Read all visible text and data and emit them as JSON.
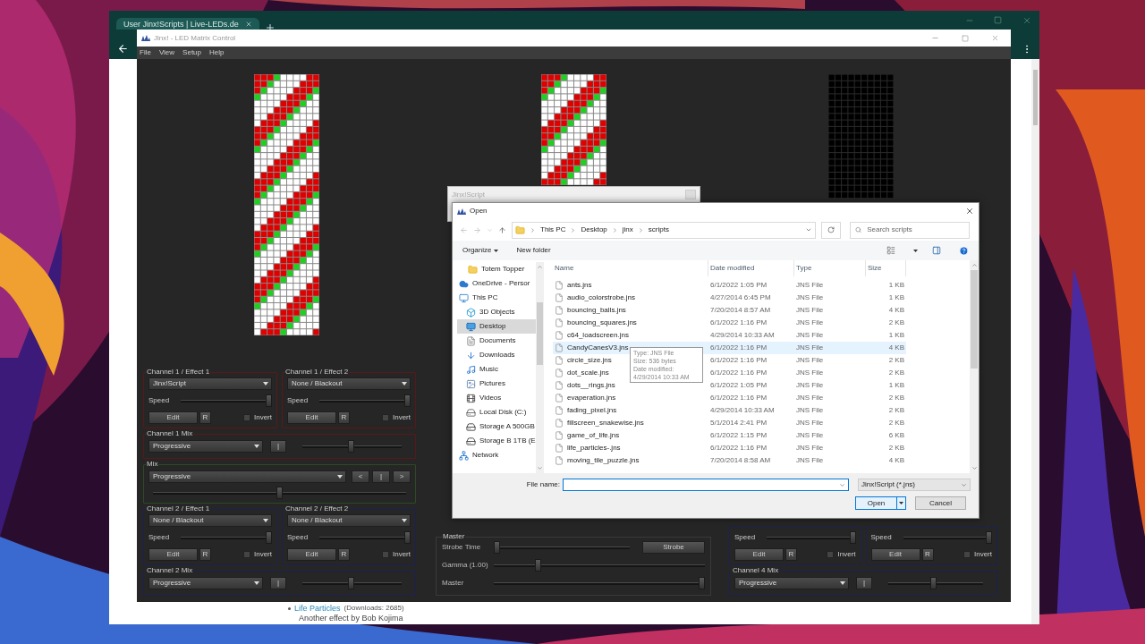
{
  "browser": {
    "tab_title": "User Jinx!Scripts | Live-LEDs.de"
  },
  "app": {
    "title": "Jinx! - LED Matrix Control",
    "menu": [
      "File",
      "View",
      "Setup",
      "Help"
    ]
  },
  "previews": [
    {
      "kind": "pattern"
    },
    {
      "kind": "pattern"
    },
    {
      "kind": "blank"
    }
  ],
  "left_panel": [
    {
      "kind": "effects",
      "color": "#5a1818",
      "effects": [
        {
          "title": "Channel 1 / Effect 1",
          "effect": "Jinx!Script",
          "speed": {
            "label": "Speed",
            "level": 1
          },
          "edit": "Edit",
          "reset": "R",
          "invert": {
            "label": "Invert",
            "checked": false
          }
        },
        {
          "title": "Channel 1 / Effect 2",
          "effect": "None / Blackout",
          "speed": {
            "label": "Speed",
            "level": 1
          },
          "edit": "Edit",
          "reset": "R",
          "invert": {
            "label": "Invert",
            "checked": false
          }
        }
      ]
    },
    {
      "kind": "channel_mix",
      "color": "#5a1818",
      "title": "Channel 1 Mix",
      "mode": "Progressive",
      "toggle": "|",
      "level": 0.49
    },
    {
      "kind": "mix",
      "color": "#2c4a24",
      "title": "Mix",
      "mode": "Progressive",
      "buttons": [
        "<",
        "|",
        ">"
      ],
      "level": 0.5
    },
    {
      "kind": "effects",
      "color": "#1c2150",
      "effects": [
        {
          "title": "Channel 2 / Effect 1",
          "effect": "None / Blackout",
          "speed": {
            "label": "Speed",
            "level": 1
          },
          "edit": "Edit",
          "reset": "R",
          "invert": {
            "label": "Invert",
            "checked": false
          }
        },
        {
          "title": "Channel 2 / Effect 2",
          "effect": "None / Blackout",
          "speed": {
            "label": "Speed",
            "level": 1
          },
          "edit": "Edit",
          "reset": "R",
          "invert": {
            "label": "Invert",
            "checked": false
          }
        }
      ]
    },
    {
      "kind": "channel_mix",
      "color": "#1c2150",
      "title": "Channel 2 Mix",
      "mode": "Progressive",
      "toggle": "|",
      "level": 0.49
    }
  ],
  "master": {
    "title": "Master",
    "rows": [
      {
        "label": "Strobe Time",
        "level": 0,
        "button": "Strobe"
      },
      {
        "label": "Gamma (1.00)",
        "level": 0.2
      },
      {
        "label": "Master",
        "level": 1
      }
    ]
  },
  "right_panel": [
    {
      "kind": "effects",
      "color": "#1c2150",
      "effects": [
        {
          "speed": {
            "label": "Speed",
            "level": 1
          },
          "edit": "Edit",
          "reset": "R",
          "invert": {
            "label": "Invert",
            "checked": false
          }
        },
        {
          "speed": {
            "label": "Speed",
            "level": 1
          },
          "edit": "Edit",
          "reset": "R",
          "invert": {
            "label": "Invert",
            "checked": false
          }
        }
      ]
    },
    {
      "kind": "channel_mix",
      "color": "#1c2150",
      "title": "Channel 4 Mix",
      "mode": "Progressive",
      "toggle": "|",
      "level": 0.47
    }
  ],
  "script_window": {
    "title": "Jinx!Script"
  },
  "open_dialog": {
    "title": "Open",
    "path": [
      "This PC",
      "Desktop",
      "jinx",
      "scripts"
    ],
    "search": {
      "placeholder": "Search scripts"
    },
    "organize": "Organize",
    "new_folder": "New folder",
    "nav": [
      {
        "label": "Totem Topper",
        "kind": "folder",
        "selected": false
      },
      {
        "label": "OneDrive - Persor",
        "kind": "cloud",
        "selected": false
      },
      {
        "label": "This PC",
        "kind": "pc",
        "selected": false
      },
      {
        "label": "3D Objects",
        "kind": "cube",
        "selected": false
      },
      {
        "label": "Desktop",
        "kind": "desktop",
        "selected": true
      },
      {
        "label": "Documents",
        "kind": "document",
        "selected": false
      },
      {
        "label": "Downloads",
        "kind": "download",
        "selected": false
      },
      {
        "label": "Music",
        "kind": "music",
        "selected": false
      },
      {
        "label": "Pictures",
        "kind": "picture",
        "selected": false
      },
      {
        "label": "Videos",
        "kind": "video",
        "selected": false
      },
      {
        "label": "Local Disk (C:)",
        "kind": "disk",
        "selected": false
      },
      {
        "label": "Storage A 500GB",
        "kind": "drive",
        "selected": false
      },
      {
        "label": "Storage B 1TB (E",
        "kind": "drive",
        "selected": false
      },
      {
        "label": "Network",
        "kind": "network",
        "selected": false
      }
    ],
    "columns": [
      "Name",
      "Date modified",
      "Type",
      "Size"
    ],
    "files": [
      {
        "name": "ants.jns",
        "date": "6/1/2022 1:05 PM",
        "type": "JNS File",
        "size": "1 KB",
        "hovered": false
      },
      {
        "name": "audio_colorstrobe.jns",
        "date": "4/27/2014 6:45 PM",
        "type": "JNS File",
        "size": "1 KB",
        "hovered": false
      },
      {
        "name": "bouncing_balls.jns",
        "date": "7/20/2014 8:57 AM",
        "type": "JNS File",
        "size": "4 KB",
        "hovered": false
      },
      {
        "name": "bouncing_squares.jns",
        "date": "6/1/2022 1:16 PM",
        "type": "JNS File",
        "size": "2 KB",
        "hovered": false
      },
      {
        "name": "c64_loadscreen.jns",
        "date": "4/29/2014 10:33 AM",
        "type": "JNS File",
        "size": "1 KB",
        "hovered": false
      },
      {
        "name": "CandyCanesV3.jns",
        "date": "6/1/2022 1:16 PM",
        "type": "JNS File",
        "size": "4 KB",
        "hovered": true
      },
      {
        "name": "circle_size.jns",
        "date": "6/1/2022 1:16 PM",
        "type": "JNS File",
        "size": "2 KB",
        "hovered": false
      },
      {
        "name": "dot_scale.jns",
        "date": "6/1/2022 1:16 PM",
        "type": "JNS File",
        "size": "2 KB",
        "hovered": false
      },
      {
        "name": "dots__rings.jns",
        "date": "6/1/2022 1:05 PM",
        "type": "JNS File",
        "size": "1 KB",
        "hovered": false
      },
      {
        "name": "evaperation.jns",
        "date": "6/1/2022 1:16 PM",
        "type": "JNS File",
        "size": "2 KB",
        "hovered": false
      },
      {
        "name": "fading_pixel.jns",
        "date": "4/29/2014 10:33 AM",
        "type": "JNS File",
        "size": "2 KB",
        "hovered": false
      },
      {
        "name": "fillscreen_snakewise.jns",
        "date": "5/1/2014 2:41 PM",
        "type": "JNS File",
        "size": "2 KB",
        "hovered": false
      },
      {
        "name": "game_of_life.jns",
        "date": "6/1/2022 1:15 PM",
        "type": "JNS File",
        "size": "6 KB",
        "hovered": false
      },
      {
        "name": "life_particles-.jns",
        "date": "6/1/2022 1:16 PM",
        "type": "JNS File",
        "size": "2 KB",
        "hovered": false
      },
      {
        "name": "moving_tile_puzzle.jns",
        "date": "7/20/2014 8:58 AM",
        "type": "JNS File",
        "size": "4 KB",
        "hovered": false
      }
    ],
    "tooltip": [
      "Type: JNS File",
      "Size: 536 bytes",
      "Date modified: 4/29/2014 10:33 AM"
    ],
    "file_name_label": "File name:",
    "file_type": "Jinx!Script (*.jns)",
    "open": "Open",
    "cancel": "Cancel"
  },
  "page": {
    "link": "Life Particles",
    "link_meta": "(Downloads: 2685)",
    "text": "Another effect by Bob Kojima"
  }
}
